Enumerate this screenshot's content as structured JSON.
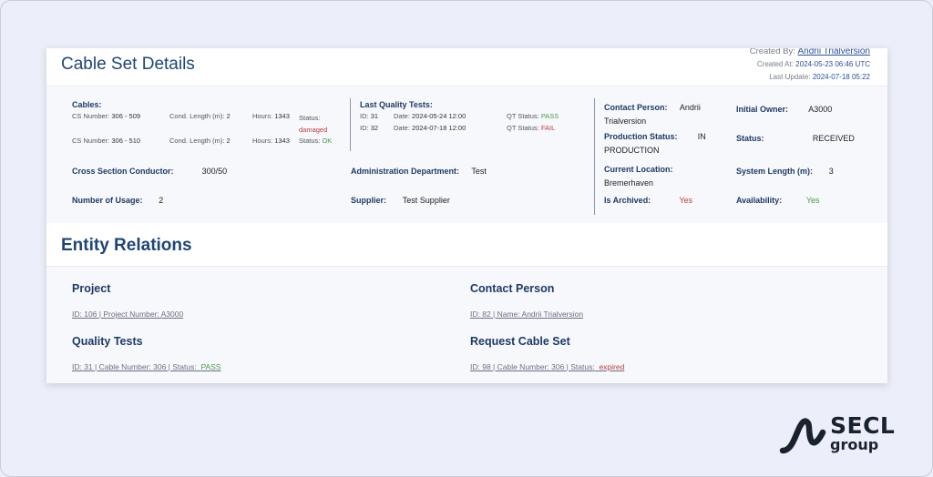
{
  "header": {
    "title": "Cable Set Details",
    "created_by_label": "Created By:",
    "created_by": "Andrii Trialversion",
    "created_at_label": "Created At:",
    "created_at": "2024-05-23 06:46 UTC",
    "last_update_label": "Last Update:",
    "last_update": "2024-07-18 05:22"
  },
  "cables": {
    "label": "Cables:",
    "items": [
      {
        "cs_label": "CS Number:",
        "cs": "306 - 509",
        "len_label": "Cond. Length (m):",
        "len": "2",
        "hours_label": "Hours:",
        "hours": "1343",
        "status_label": "Status:",
        "status": "damaged"
      },
      {
        "cs_label": "CS Number:",
        "cs": "306 - 510",
        "len_label": "Cond. Length (m):",
        "len": "2",
        "hours_label": "Hours:",
        "hours": "1343",
        "status_label": "Status:",
        "status": "OK"
      }
    ]
  },
  "quality_tests": {
    "label": "Last Quality Tests:",
    "items": [
      {
        "id_label": "ID:",
        "id": "31",
        "date_label": "Date:",
        "date": "2024-05-24 12:00",
        "qt_label": "QT Status:",
        "qt": "PASS"
      },
      {
        "id_label": "ID:",
        "id": "32",
        "date_label": "Date:",
        "date": "2024-07-18 12:00",
        "qt_label": "QT Status:",
        "qt": "FAIL"
      }
    ]
  },
  "fields": {
    "contact_person_label": "Contact Person:",
    "contact_person": "Andrii Trialversion",
    "initial_owner_label": "Initial Owner:",
    "initial_owner": "A3000",
    "production_status_label": "Production Status:",
    "production_status": "IN PRODUCTION",
    "status_label": "Status:",
    "status": "RECEIVED",
    "cross_section_label": "Cross Section Conductor:",
    "cross_section": "300/50",
    "admin_dept_label": "Administration Department:",
    "admin_dept": "Test",
    "current_location_label": "Current Location:",
    "current_location": "Bremerhaven",
    "system_length_label": "System Length (m):",
    "system_length": "3",
    "usage_label": "Number of Usage:",
    "usage": "2",
    "supplier_label": "Supplier:",
    "supplier": "Test Supplier",
    "archived_label": "Is Archived:",
    "archived": "Yes",
    "availability_label": "Availability:",
    "availability": "Yes"
  },
  "relations": {
    "title": "Entity Relations",
    "project_title": "Project",
    "project_link": "ID: 106 | Project Number: A3000",
    "contact_title": "Contact Person",
    "contact_link": "ID: 82 | Name: Andrii Trialversion",
    "qt_title": "Quality Tests",
    "qt_link": "ID: 31 | Cable Number: 306 | Status:",
    "qt_status": "PASS",
    "request_title": "Request Cable Set",
    "request_link": "ID: 98 | Cable Number: 306 | Status:",
    "request_status": "expired"
  },
  "brand": {
    "line1": "SECL",
    "line2": "group"
  },
  "colors": {
    "accent": "#1e4576",
    "pass": "#4a9a45",
    "fail": "#c23a3a",
    "background": "#eceff9"
  }
}
